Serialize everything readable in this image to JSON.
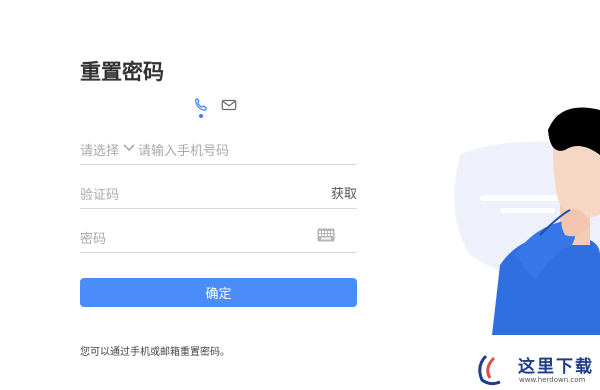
{
  "page": {
    "title": "重置密码",
    "tabs": [
      {
        "icon": "phone-icon",
        "active": true
      },
      {
        "icon": "mail-icon",
        "active": false
      }
    ],
    "accent_color": "#4b8df8"
  },
  "form": {
    "country_select_label": "请选择",
    "phone_placeholder": "请输入手机号码",
    "code_placeholder": "验证码",
    "fetch_code_label": "获取",
    "password_placeholder": "密码",
    "submit_label": "确定"
  },
  "footer": {
    "hint": "您可以通过手机或邮箱重置密码。"
  },
  "watermark": {
    "brand_text": "这里下载",
    "brand_url": "www.herdown.com"
  }
}
